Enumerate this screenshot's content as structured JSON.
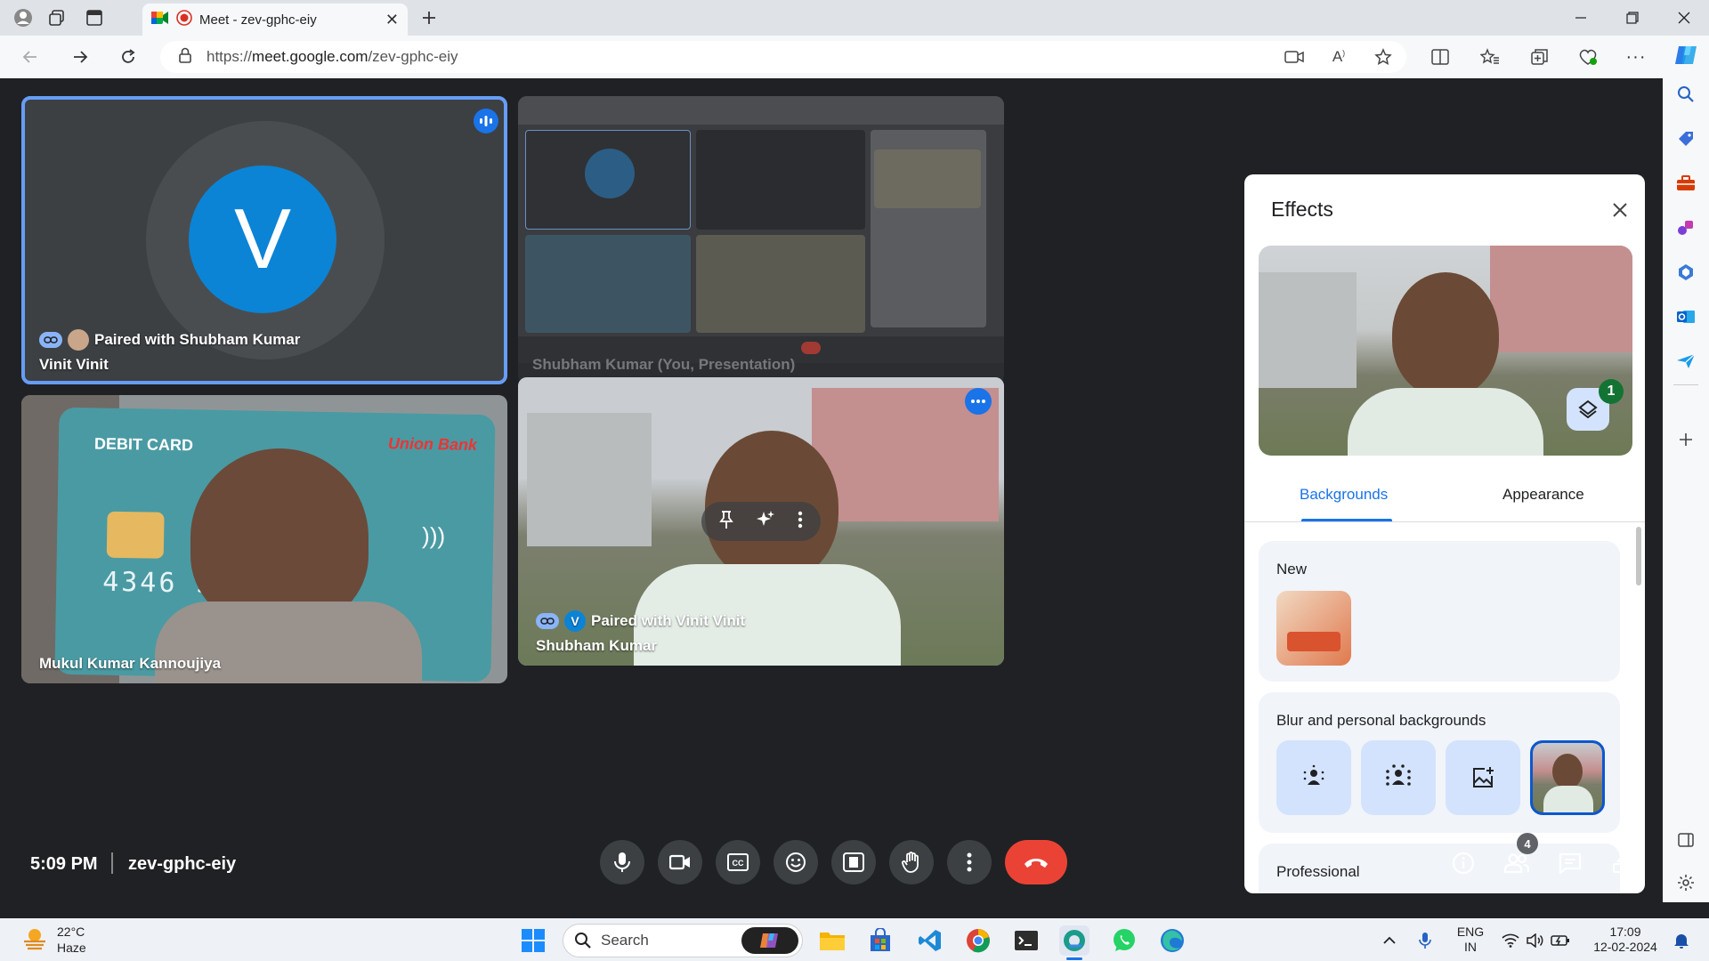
{
  "browser": {
    "tab_title": "Meet - zev-gphc-eiy",
    "url_prefix": "https://",
    "url_host": "meet.google.com",
    "url_path": "/zev-gphc-eiy"
  },
  "tiles": {
    "vinit": {
      "avatar_letter": "V",
      "pair_text": "Paired with Shubham Kumar",
      "name": "Vinit Vinit"
    },
    "presentation": {
      "caption": "Shubham Kumar (You, Presentation)"
    },
    "mukul": {
      "name": "Mukul Kumar Kannoujiya",
      "card_label": "DEBIT CARD",
      "card_digits": "4346  5      6  6562",
      "bank": "Union Bank"
    },
    "shubham": {
      "pair_avatar_letter": "V",
      "pair_text": "Paired with Vinit Vinit",
      "name": "Shubham Kumar"
    }
  },
  "bottom_bar": {
    "time": "5:09 PM",
    "meeting_code": "zev-gphc-eiy",
    "people_badge": "4"
  },
  "effects": {
    "title": "Effects",
    "preview_badge": "1",
    "tabs": [
      "Backgrounds",
      "Appearance"
    ],
    "sections": {
      "new": "New",
      "blur": "Blur and personal backgrounds",
      "professional": "Professional"
    }
  },
  "taskbar": {
    "temperature": "22°C",
    "weather": "Haze",
    "search_placeholder": "Search",
    "lang_top": "ENG",
    "lang_bottom": "IN",
    "time": "17:09",
    "date": "12-02-2024"
  },
  "colors": {
    "accent": "#1a73e8",
    "tile_outline": "#669df6",
    "end_call": "#ea4335",
    "avatar": "#0b84d6"
  }
}
